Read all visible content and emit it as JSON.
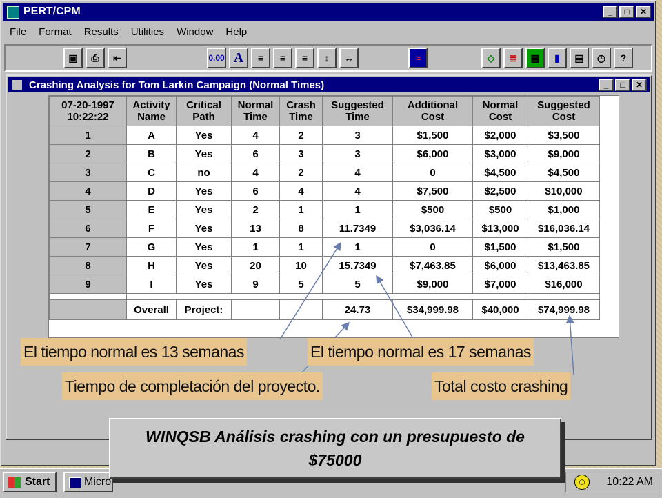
{
  "app": {
    "title": "PERT/CPM"
  },
  "window_buttons": {
    "minimize": "_",
    "maximize": "□",
    "close": "✕"
  },
  "menu": [
    "File",
    "Format",
    "Results",
    "Utilities",
    "Window",
    "Help"
  ],
  "toolbar": {
    "number_format": "0.00",
    "font_button": "A"
  },
  "child_window": {
    "title": "Crashing Analysis for Tom Larkin Campaign (Normal Times)"
  },
  "grid": {
    "corner": [
      "07-20-1997",
      "10:22:22"
    ],
    "headers": [
      [
        "Activity",
        "Name"
      ],
      [
        "Critical",
        "Path"
      ],
      [
        "Normal",
        "Time"
      ],
      [
        "Crash",
        "Time"
      ],
      [
        "Suggested",
        "Time"
      ],
      [
        "Additional",
        "Cost"
      ],
      [
        "Normal",
        "Cost"
      ],
      [
        "Suggested",
        "Cost"
      ]
    ],
    "rows": [
      {
        "num": "1",
        "cells": [
          "A",
          "Yes",
          "4",
          "2",
          "3",
          "$1,500",
          "$2,000",
          "$3,500"
        ]
      },
      {
        "num": "2",
        "cells": [
          "B",
          "Yes",
          "6",
          "3",
          "3",
          "$6,000",
          "$3,000",
          "$9,000"
        ]
      },
      {
        "num": "3",
        "cells": [
          "C",
          "no",
          "4",
          "2",
          "4",
          "0",
          "$4,500",
          "$4,500"
        ]
      },
      {
        "num": "4",
        "cells": [
          "D",
          "Yes",
          "6",
          "4",
          "4",
          "$7,500",
          "$2,500",
          "$10,000"
        ]
      },
      {
        "num": "5",
        "cells": [
          "E",
          "Yes",
          "2",
          "1",
          "1",
          "$500",
          "$500",
          "$1,000"
        ]
      },
      {
        "num": "6",
        "cells": [
          "F",
          "Yes",
          "13",
          "8",
          "11.7349",
          "$3,036.14",
          "$13,000",
          "$16,036.14"
        ]
      },
      {
        "num": "7",
        "cells": [
          "G",
          "Yes",
          "1",
          "1",
          "1",
          "0",
          "$1,500",
          "$1,500"
        ]
      },
      {
        "num": "8",
        "cells": [
          "H",
          "Yes",
          "20",
          "10",
          "15.7349",
          "$7,463.85",
          "$6,000",
          "$13,463.85"
        ]
      },
      {
        "num": "9",
        "cells": [
          "I",
          "Yes",
          "9",
          "5",
          "5",
          "$9,000",
          "$7,000",
          "$16,000"
        ]
      }
    ],
    "total": [
      "",
      "Overall",
      "Project:",
      "",
      "",
      "24.73",
      "$34,999.98",
      "$40,000",
      "$74,999.98"
    ]
  },
  "annotations": {
    "normal13": "El tiempo normal es 13 semanas",
    "normal17": "El tiempo normal es 17 semanas",
    "completion": "Tiempo de completación del proyecto.",
    "total_cost": "Total costo crashing"
  },
  "banner": {
    "line1": "WINQSB Análisis crashing con un presupuesto de",
    "line2": "$75000"
  },
  "taskbar": {
    "start": "Start",
    "task": "Micro",
    "clock": "10:22 AM"
  }
}
